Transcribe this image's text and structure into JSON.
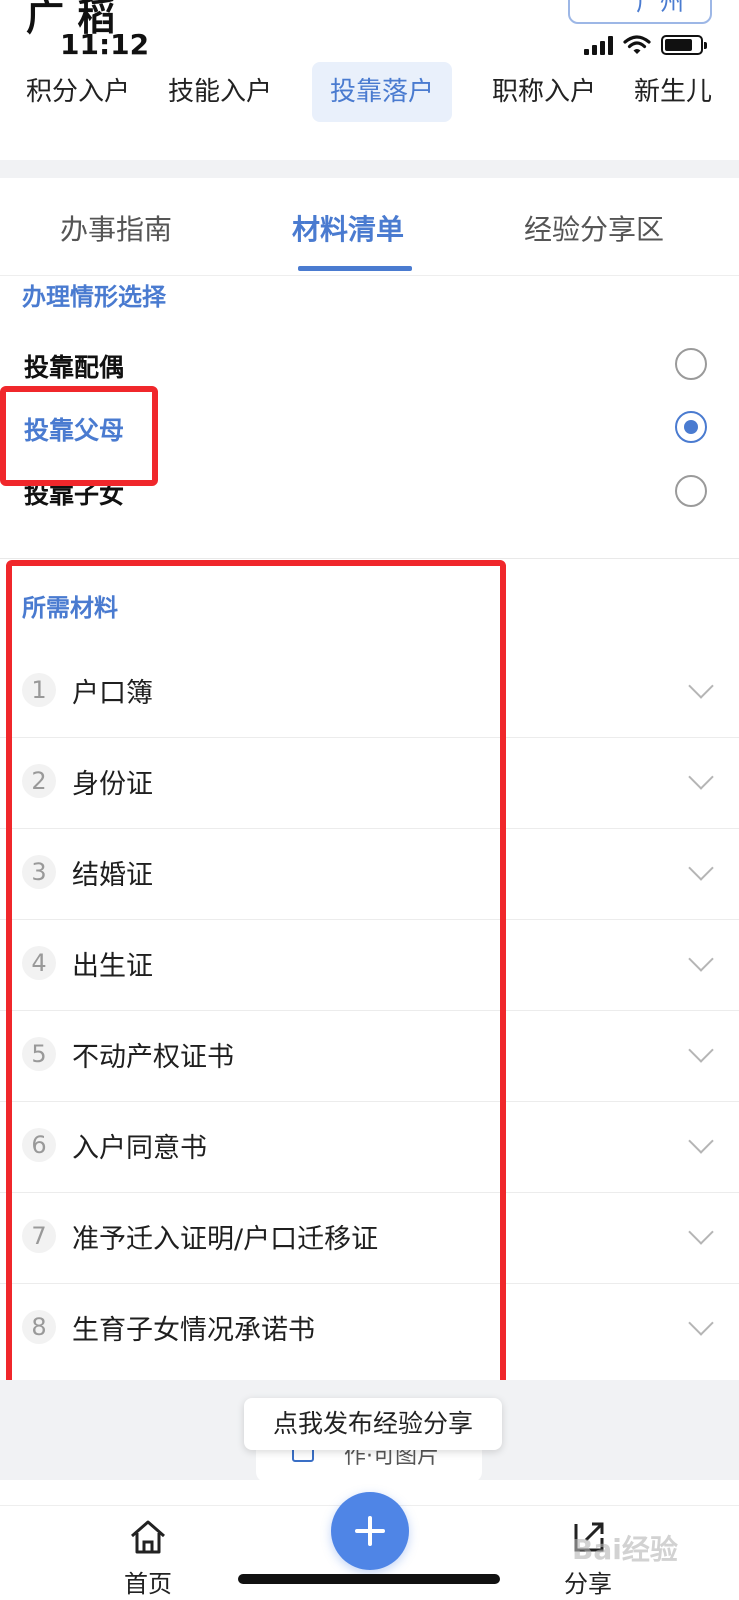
{
  "status_bar": {
    "partial_title": "广 稻",
    "city_button": "广州",
    "time": "11:12"
  },
  "category_tabs": [
    {
      "label": "积分入户",
      "active": false
    },
    {
      "label": "技能入户",
      "active": false
    },
    {
      "label": "投靠落户",
      "active": true
    },
    {
      "label": "职称入户",
      "active": false
    },
    {
      "label": "新生儿",
      "active": false
    }
  ],
  "sub_tabs": [
    {
      "label": "办事指南",
      "active": false
    },
    {
      "label": "材料清单",
      "active": true
    },
    {
      "label": "经验分享区",
      "active": false
    }
  ],
  "situation": {
    "header": "办理情形选择",
    "options": [
      {
        "label": "投靠配偶",
        "selected": false
      },
      {
        "label": "投靠父母",
        "selected": true
      },
      {
        "label": "投靠子女",
        "selected": false
      }
    ]
  },
  "materials": {
    "header": "所需材料",
    "items": [
      {
        "num": "1",
        "name": "户口簿"
      },
      {
        "num": "2",
        "name": "身份证"
      },
      {
        "num": "3",
        "name": "结婚证"
      },
      {
        "num": "4",
        "name": "出生证"
      },
      {
        "num": "5",
        "name": "不动产权证书"
      },
      {
        "num": "6",
        "name": "入户同意书"
      },
      {
        "num": "7",
        "name": "准予迁入证明/户口迁移证"
      },
      {
        "num": "8",
        "name": "生育子女情况承诺书"
      }
    ]
  },
  "share": {
    "tooltip": "点我发布经验分享",
    "card_text": "作·可图片"
  },
  "bottom_nav": {
    "home": "首页",
    "share": "分享"
  },
  "watermark": "Bai经验",
  "colors": {
    "accent": "#4a7bd0",
    "highlight": "#f0272b",
    "fab": "#4f85e6"
  }
}
